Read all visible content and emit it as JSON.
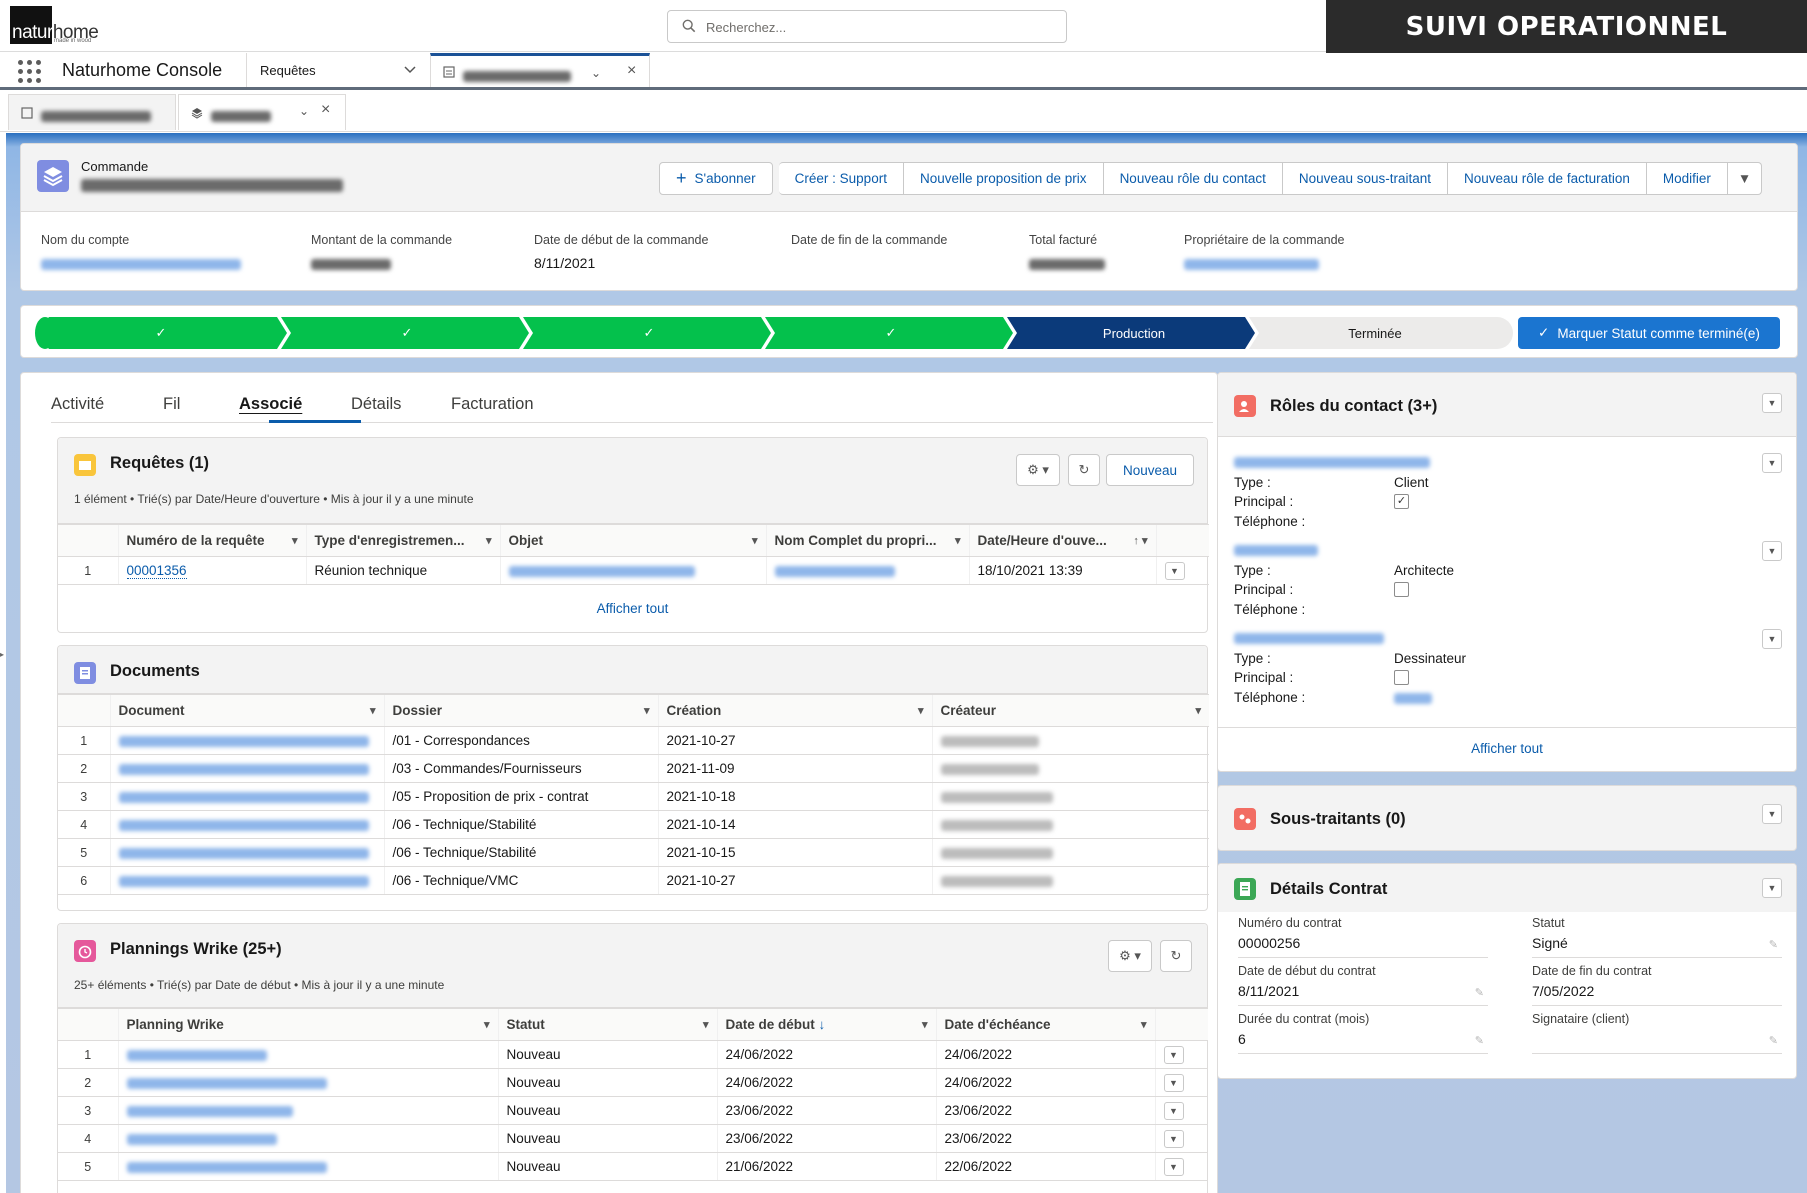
{
  "topbar": {
    "logo_part1": "natur",
    "logo_part2": "home",
    "logo_sub": "made in wood",
    "search_placeholder": "Recherchez...",
    "banner": "SUIVI OPERATIONNEL"
  },
  "nav": {
    "app_name": "Naturhome Console",
    "selector": "Requêtes",
    "open_tab_label": ""
  },
  "subtabs": [
    "",
    ""
  ],
  "record": {
    "type_label": "Commande",
    "name": "",
    "actions": [
      "S'abonner",
      "Créer : Support",
      "Nouvelle proposition de prix",
      "Nouveau rôle du contact",
      "Nouveau sous-traitant",
      "Nouveau rôle de facturation",
      "Modifier"
    ],
    "fields": [
      {
        "label": "Nom du compte",
        "value": ""
      },
      {
        "label": "Montant de la commande",
        "value": ""
      },
      {
        "label": "Date de début de la commande",
        "value": "8/11/2021"
      },
      {
        "label": "Date de fin de la commande",
        "value": ""
      },
      {
        "label": "Total facturé",
        "value": ""
      },
      {
        "label": "Propriétaire de la commande",
        "value": ""
      }
    ]
  },
  "path": {
    "steps": [
      "✓",
      "✓",
      "✓",
      "✓",
      "Production",
      "Terminée"
    ],
    "mark_button": "Marquer Statut comme terminé(e)"
  },
  "tabs": [
    "Activité",
    "Fil",
    "Associé",
    "Détails",
    "Facturation"
  ],
  "requetes": {
    "title": "Requêtes (1)",
    "subtitle": "1 élément • Trié(s) par Date/Heure d'ouverture • Mis à jour il y a une minute",
    "new_button": "Nouveau",
    "columns": [
      "Numéro de la requête",
      "Type d'enregistremen...",
      "Objet",
      "Nom Complet du propri...",
      "Date/Heure d'ouve..."
    ],
    "rows": [
      {
        "n": "1",
        "num": "00001356",
        "type": "Réunion technique",
        "date": "18/10/2021 13:39"
      }
    ],
    "show_all": "Afficher tout"
  },
  "documents": {
    "title": "Documents",
    "columns": [
      "Document",
      "Dossier",
      "Création",
      "Créateur"
    ],
    "rows": [
      {
        "n": "1",
        "folder": "/01 - Correspondances",
        "date": "2021-10-27"
      },
      {
        "n": "2",
        "folder": "/03 - Commandes/Fournisseurs",
        "date": "2021-11-09"
      },
      {
        "n": "3",
        "folder": "/05 - Proposition de prix - contrat",
        "date": "2021-10-18"
      },
      {
        "n": "4",
        "folder": "/06 - Technique/Stabilité",
        "date": "2021-10-14"
      },
      {
        "n": "5",
        "folder": "/06 - Technique/Stabilité",
        "date": "2021-10-15"
      },
      {
        "n": "6",
        "folder": "/06 - Technique/VMC",
        "date": "2021-10-27"
      }
    ]
  },
  "plannings": {
    "title": "Plannings Wrike (25+)",
    "subtitle": "25+ éléments • Trié(s) par Date de début • Mis à jour il y a une minute",
    "columns": [
      "Planning Wrike",
      "Statut",
      "Date de début",
      "Date d'échéance"
    ],
    "rows": [
      {
        "n": "1",
        "status": "Nouveau",
        "start": "24/06/2022",
        "due": "24/06/2022"
      },
      {
        "n": "2",
        "status": "Nouveau",
        "start": "24/06/2022",
        "due": "24/06/2022"
      },
      {
        "n": "3",
        "status": "Nouveau",
        "start": "23/06/2022",
        "due": "23/06/2022"
      },
      {
        "n": "4",
        "status": "Nouveau",
        "start": "23/06/2022",
        "due": "23/06/2022"
      },
      {
        "n": "5",
        "status": "Nouveau",
        "start": "21/06/2022",
        "due": "22/06/2022"
      }
    ]
  },
  "roles": {
    "title": "Rôles du contact (3+)",
    "labels": {
      "type": "Type :",
      "principal": "Principal :",
      "telephone": "Téléphone :"
    },
    "items": [
      {
        "type": "Client",
        "principal": true
      },
      {
        "type": "Architecte",
        "principal": false
      },
      {
        "type": "Dessinateur",
        "principal": false
      }
    ],
    "show_all": "Afficher tout"
  },
  "soustraitants": {
    "title": "Sous-traitants (0)"
  },
  "contrat": {
    "title": "Détails Contrat",
    "fields": [
      {
        "label": "Numéro du contrat",
        "value": "00000256"
      },
      {
        "label": "Statut",
        "value": "Signé"
      },
      {
        "label": "Date de début du contrat",
        "value": "8/11/2021"
      },
      {
        "label": "Date de fin du contrat",
        "value": "7/05/2022"
      },
      {
        "label": "Durée du contrat (mois)",
        "value": "6"
      },
      {
        "label": "Signataire (client)",
        "value": ""
      }
    ]
  },
  "colors": {
    "accent": "#0b5cab",
    "path_done": "#04c14c",
    "path_current": "#0b3a7a",
    "banner_bg": "#2b2b2b"
  }
}
